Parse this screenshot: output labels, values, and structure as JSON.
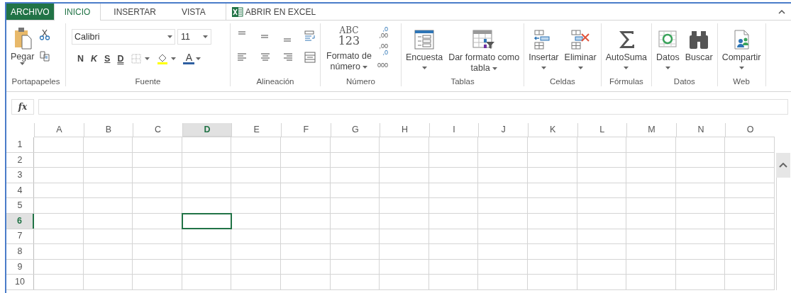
{
  "tabs": [
    {
      "label": "ARCHIVO",
      "kind": "file",
      "selected": false
    },
    {
      "label": "INICIO",
      "kind": "tab",
      "selected": true
    },
    {
      "label": "INSERTAR",
      "kind": "tab",
      "selected": false
    },
    {
      "label": "VISTA",
      "kind": "tab",
      "selected": false
    },
    {
      "label": "ABRIR EN EXCEL",
      "kind": "excel",
      "selected": false
    }
  ],
  "ribbon": {
    "groups": [
      {
        "kind": "clipboard",
        "label": "Portapapeles",
        "paste": {
          "label": "Pegar",
          "dropdown": true
        }
      },
      {
        "kind": "font",
        "label": "Fuente",
        "font_name": "Calibri",
        "font_size": "11",
        "styles": [
          "N",
          "K",
          "S",
          "D"
        ],
        "font_color": "A"
      },
      {
        "kind": "alignment",
        "label": "Alineación"
      },
      {
        "kind": "number",
        "label": "Número",
        "format_icon": [
          "ABC",
          "123"
        ],
        "format_label": [
          "Formato de",
          "número"
        ],
        "increase_decimal": [
          ",0",
          ",00"
        ],
        "decrease_decimal": [
          ",00",
          ",0"
        ],
        "thousands": "000"
      },
      {
        "kind": "buttons",
        "label": "Tablas",
        "buttons": [
          {
            "lines": [
              "Encuesta"
            ],
            "dropdown": true
          },
          {
            "lines": [
              "Dar formato como",
              "tabla"
            ],
            "dropdown": true
          }
        ]
      },
      {
        "kind": "buttons",
        "label": "Celdas",
        "buttons": [
          {
            "lines": [
              "Insertar"
            ],
            "dropdown": true
          },
          {
            "lines": [
              "Eliminar"
            ],
            "dropdown": true
          }
        ]
      },
      {
        "kind": "buttons",
        "label": "Fórmulas",
        "buttons": [
          {
            "lines": [
              "AutoSuma"
            ],
            "dropdown": true
          }
        ]
      },
      {
        "kind": "buttons",
        "label": "Datos",
        "buttons": [
          {
            "lines": [
              "Datos"
            ],
            "dropdown": true
          },
          {
            "lines": [
              "Buscar"
            ],
            "dropdown": false
          }
        ]
      },
      {
        "kind": "buttons",
        "label": "Web",
        "buttons": [
          {
            "lines": [
              "Compartir"
            ],
            "dropdown": true
          }
        ]
      }
    ]
  },
  "formula_bar": {
    "button": "fx"
  },
  "grid": {
    "columns": [
      {
        "label": "A",
        "selected": false
      },
      {
        "label": "B",
        "selected": false
      },
      {
        "label": "C",
        "selected": false
      },
      {
        "label": "D",
        "selected": true
      },
      {
        "label": "E",
        "selected": false
      },
      {
        "label": "F",
        "selected": false
      },
      {
        "label": "G",
        "selected": false
      },
      {
        "label": "H",
        "selected": false
      },
      {
        "label": "I",
        "selected": false
      },
      {
        "label": "J",
        "selected": false
      },
      {
        "label": "K",
        "selected": false
      },
      {
        "label": "L",
        "selected": false
      },
      {
        "label": "M",
        "selected": false
      },
      {
        "label": "N",
        "selected": false
      },
      {
        "label": "O",
        "selected": false
      }
    ],
    "rows": [
      {
        "label": "1",
        "selected": false
      },
      {
        "label": "2",
        "selected": false
      },
      {
        "label": "3",
        "selected": false
      },
      {
        "label": "4",
        "selected": false
      },
      {
        "label": "5",
        "selected": false
      },
      {
        "label": "6",
        "selected": true
      },
      {
        "label": "7",
        "selected": false
      },
      {
        "label": "8",
        "selected": false
      },
      {
        "label": "9",
        "selected": false
      },
      {
        "label": "10",
        "selected": false
      }
    ]
  }
}
